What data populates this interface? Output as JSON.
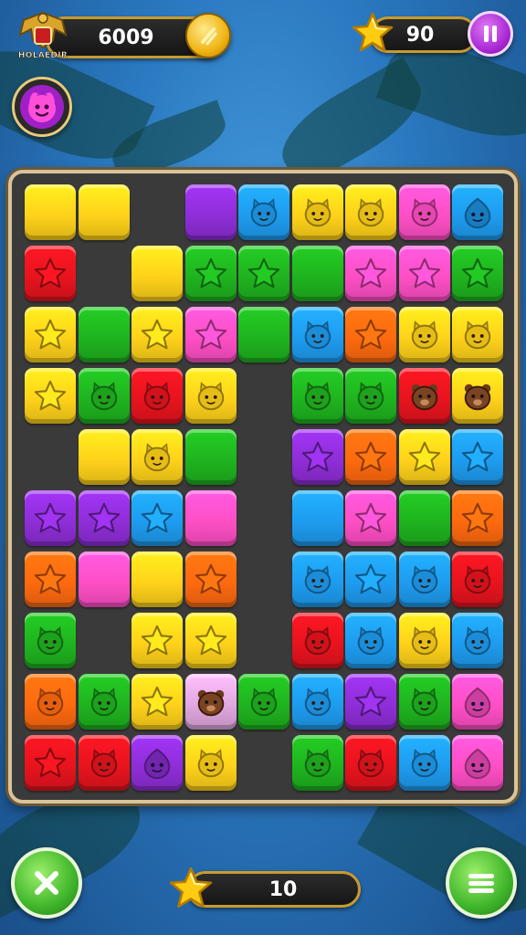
{
  "hud": {
    "score": "6009",
    "badge_text": "HOLAEDIR",
    "moves": "90",
    "collected": "10"
  },
  "colors": {
    "Y": "#ffd21a",
    "R": "#e8141e",
    "G": "#1fb41f",
    "B": "#1e9cf0",
    "P": "#8f2ed8",
    "K": "#ff4fc6",
    "O": "#ff6a0f",
    "L": "#e2a8e0"
  },
  "board": {
    "rows": [
      [
        "Y.",
        "Y.",
        null,
        "P.",
        "Bc",
        "Yc",
        "Yc",
        "Kc",
        "Bb"
      ],
      [
        "Rs",
        null,
        "Y.",
        "Gs",
        "Gs",
        "G.",
        "Ks",
        "Ks",
        "Gs"
      ],
      [
        "Ys",
        "G.",
        "Ys",
        "Ks",
        "G.",
        "Bc",
        "Os",
        "Yc",
        "Yc"
      ],
      [
        "Ys",
        "Gc",
        "Rc",
        "Yc",
        null,
        "Gc",
        "Gc",
        "Rd",
        "Yd"
      ],
      [
        null,
        "Y.",
        "Yc",
        "G.",
        null,
        "Ps",
        "Os",
        "Ys",
        "Bs"
      ],
      [
        "Ps",
        "Ps",
        "Bs",
        "K.",
        null,
        "B.",
        "Ks",
        "G.",
        "Os"
      ],
      [
        "Os",
        "K.",
        "Y.",
        "Os",
        null,
        "Bc",
        "Bs",
        "Bc",
        "Rc"
      ],
      [
        "Gc",
        null,
        "Ys",
        "Ys",
        null,
        "Rc",
        "Bc",
        "Yc",
        "Bc"
      ],
      [
        "Oc",
        "Gc",
        "Ys",
        "Ld",
        "Gc",
        "Bc",
        "Ps",
        "Gc",
        "Kb"
      ],
      [
        "Rs",
        "Rc",
        "Pb",
        "Yc",
        null,
        "Gc",
        "Rc",
        "Bc",
        "Kb"
      ]
    ]
  }
}
